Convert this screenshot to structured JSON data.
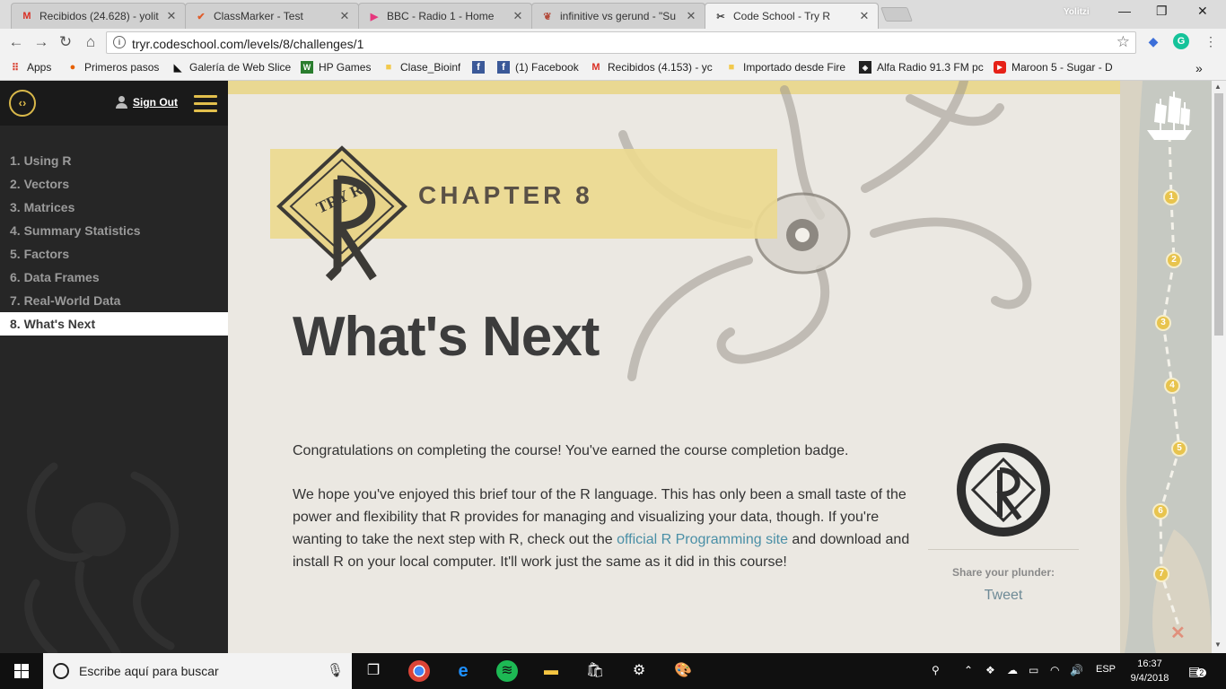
{
  "tabs": [
    {
      "label": "Recibidos (24.628) - yolit",
      "icon_name": "gmail-icon",
      "icon_color": "#d93025"
    },
    {
      "label": "ClassMarker - Test",
      "icon_name": "classmarker-icon",
      "icon_color": "#e05c2a"
    },
    {
      "label": "BBC - Radio 1 - Home",
      "icon_name": "bbc-radio-icon",
      "icon_color": "#e6377d"
    },
    {
      "label": "infinitive vs gerund - \"Su",
      "icon_name": "wordreference-icon",
      "icon_color": "#b34a3a"
    },
    {
      "label": "Code School - Try R",
      "icon_name": "code-school-icon",
      "icon_color": "#444444"
    }
  ],
  "profile_name": "Yolitzi",
  "address_bar": {
    "url": "tryr.codeschool.com/levels/8/challenges/1"
  },
  "bookmarks": [
    {
      "label": "Apps",
      "icon_name": "apps-grid-icon"
    },
    {
      "label": "Primeros pasos",
      "icon_name": "firefox-icon"
    },
    {
      "label": "Galería de Web Slice",
      "icon_name": "web-slice-icon"
    },
    {
      "label": "HP Games",
      "icon_name": "hp-games-icon"
    },
    {
      "label": "Clase_Bioinf",
      "icon_name": "folder-icon"
    },
    {
      "label": "",
      "icon_name": "facebook-icon"
    },
    {
      "label": "(1) Facebook",
      "icon_name": "facebook-icon"
    },
    {
      "label": "Recibidos (4.153) - yc",
      "icon_name": "gmail-icon"
    },
    {
      "label": "Importado desde Fire",
      "icon_name": "folder-icon"
    },
    {
      "label": "Alfa Radio 91.3 FM pc",
      "icon_name": "radio-icon"
    },
    {
      "label": "Maroon 5 - Sugar - D",
      "icon_name": "youtube-icon"
    }
  ],
  "sidebar": {
    "sign_out": "Sign Out",
    "chapters": [
      "1. Using R",
      "2. Vectors",
      "3. Matrices",
      "4. Summary Statistics",
      "5. Factors",
      "6. Data Frames",
      "7. Real-World Data",
      "8. What's Next"
    ],
    "active_chapter_index": 7
  },
  "main": {
    "chapter_label": "CHAPTER 8",
    "logo_text": "TRY R",
    "title": "What's Next",
    "paragraph1": "Congratulations on completing the course! You've earned the course completion badge.",
    "paragraph2_before": "We hope you've enjoyed this brief tour of the R language. This has only been a small taste of the power and flexibility that R provides for managing and visualizing your data, though. If you're wanting to take the next step with R, check out the ",
    "paragraph2_link": "official R Programming site",
    "paragraph2_after": " and download and install R on your local computer. It'll work just the same as it did in this course!",
    "share_label": "Share your plunder:",
    "tweet_label": "Tweet"
  },
  "map": {
    "markers": [
      "1",
      "2",
      "3",
      "4",
      "5",
      "6",
      "7"
    ],
    "end_marker": "✕"
  },
  "taskbar": {
    "search_placeholder": "Escribe aquí para buscar",
    "language": "ESP",
    "time": "16:37",
    "date": "9/4/2018",
    "notifications": "2"
  },
  "colors": {
    "accent_gold": "#e2bf4c",
    "banner_yellow": "#ecd98f",
    "link_blue": "#4a8fa6",
    "sidebar_bg": "#262626"
  }
}
